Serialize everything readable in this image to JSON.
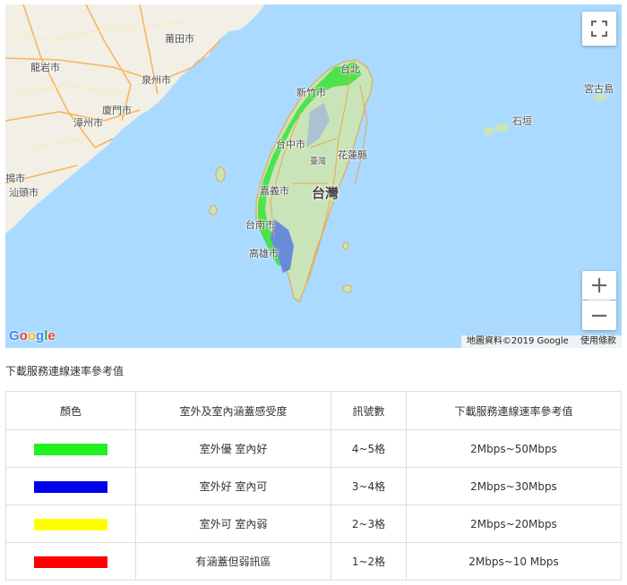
{
  "map": {
    "places": [
      {
        "key": "putian",
        "label": "莆田市"
      },
      {
        "key": "longyan",
        "label": "龍岩市"
      },
      {
        "key": "quanzhou",
        "label": "泉州市"
      },
      {
        "key": "xiamen",
        "label": "廈門市"
      },
      {
        "key": "zhangzhou",
        "label": "漳州市"
      },
      {
        "key": "shantou",
        "label": "汕頭市"
      },
      {
        "key": "shantou_partial",
        "label": "揭市"
      },
      {
        "key": "taipei",
        "label": "台北"
      },
      {
        "key": "hsinchu",
        "label": "新竹市"
      },
      {
        "key": "taichung",
        "label": "台中市"
      },
      {
        "key": "hualien",
        "label": "花蓮縣"
      },
      {
        "key": "hualien_area",
        "label": "臺灣"
      },
      {
        "key": "taiwan",
        "label": "台灣"
      },
      {
        "key": "chiayi",
        "label": "嘉義市"
      },
      {
        "key": "tainan",
        "label": "台南市"
      },
      {
        "key": "kaohsiung",
        "label": "高雄市"
      },
      {
        "key": "miyako",
        "label": "宮古島"
      },
      {
        "key": "ishigaki",
        "label": "石垣"
      }
    ],
    "logo": "Google",
    "attribution_data": "地圖資料©2019 Google",
    "attribution_terms": "使用條款",
    "controls": {
      "fullscreen_icon": "fullscreen-icon",
      "zoom_in": "+",
      "zoom_out": "−"
    }
  },
  "caption": "下載服務連線速率參考值",
  "legend": {
    "headers": [
      "顏色",
      "室外及室內涵蓋感受度",
      "訊號數",
      "下載服務連線速率參考值"
    ],
    "rows": [
      {
        "color": "#21f021",
        "coverage": "室外優 室內好",
        "bars": "4~5格",
        "speed": "2Mbps~50Mbps"
      },
      {
        "color": "#0000e8",
        "coverage": "室外好 室內可",
        "bars": "3~4格",
        "speed": "2Mbps~30Mbps"
      },
      {
        "color": "#ffff00",
        "coverage": "室外可 室內弱",
        "bars": "2~3格",
        "speed": "2Mbps~20Mbps"
      },
      {
        "color": "#ff0000",
        "coverage": "有涵蓋但弱訊區",
        "bars": "1~2格",
        "speed": "2Mbps~10 Mbps"
      }
    ]
  },
  "colors": {
    "water": "#aadaff",
    "land_mainland": "#f2efe6",
    "land_taiwan": "#c9e4b8",
    "road": "#f5b65d"
  }
}
